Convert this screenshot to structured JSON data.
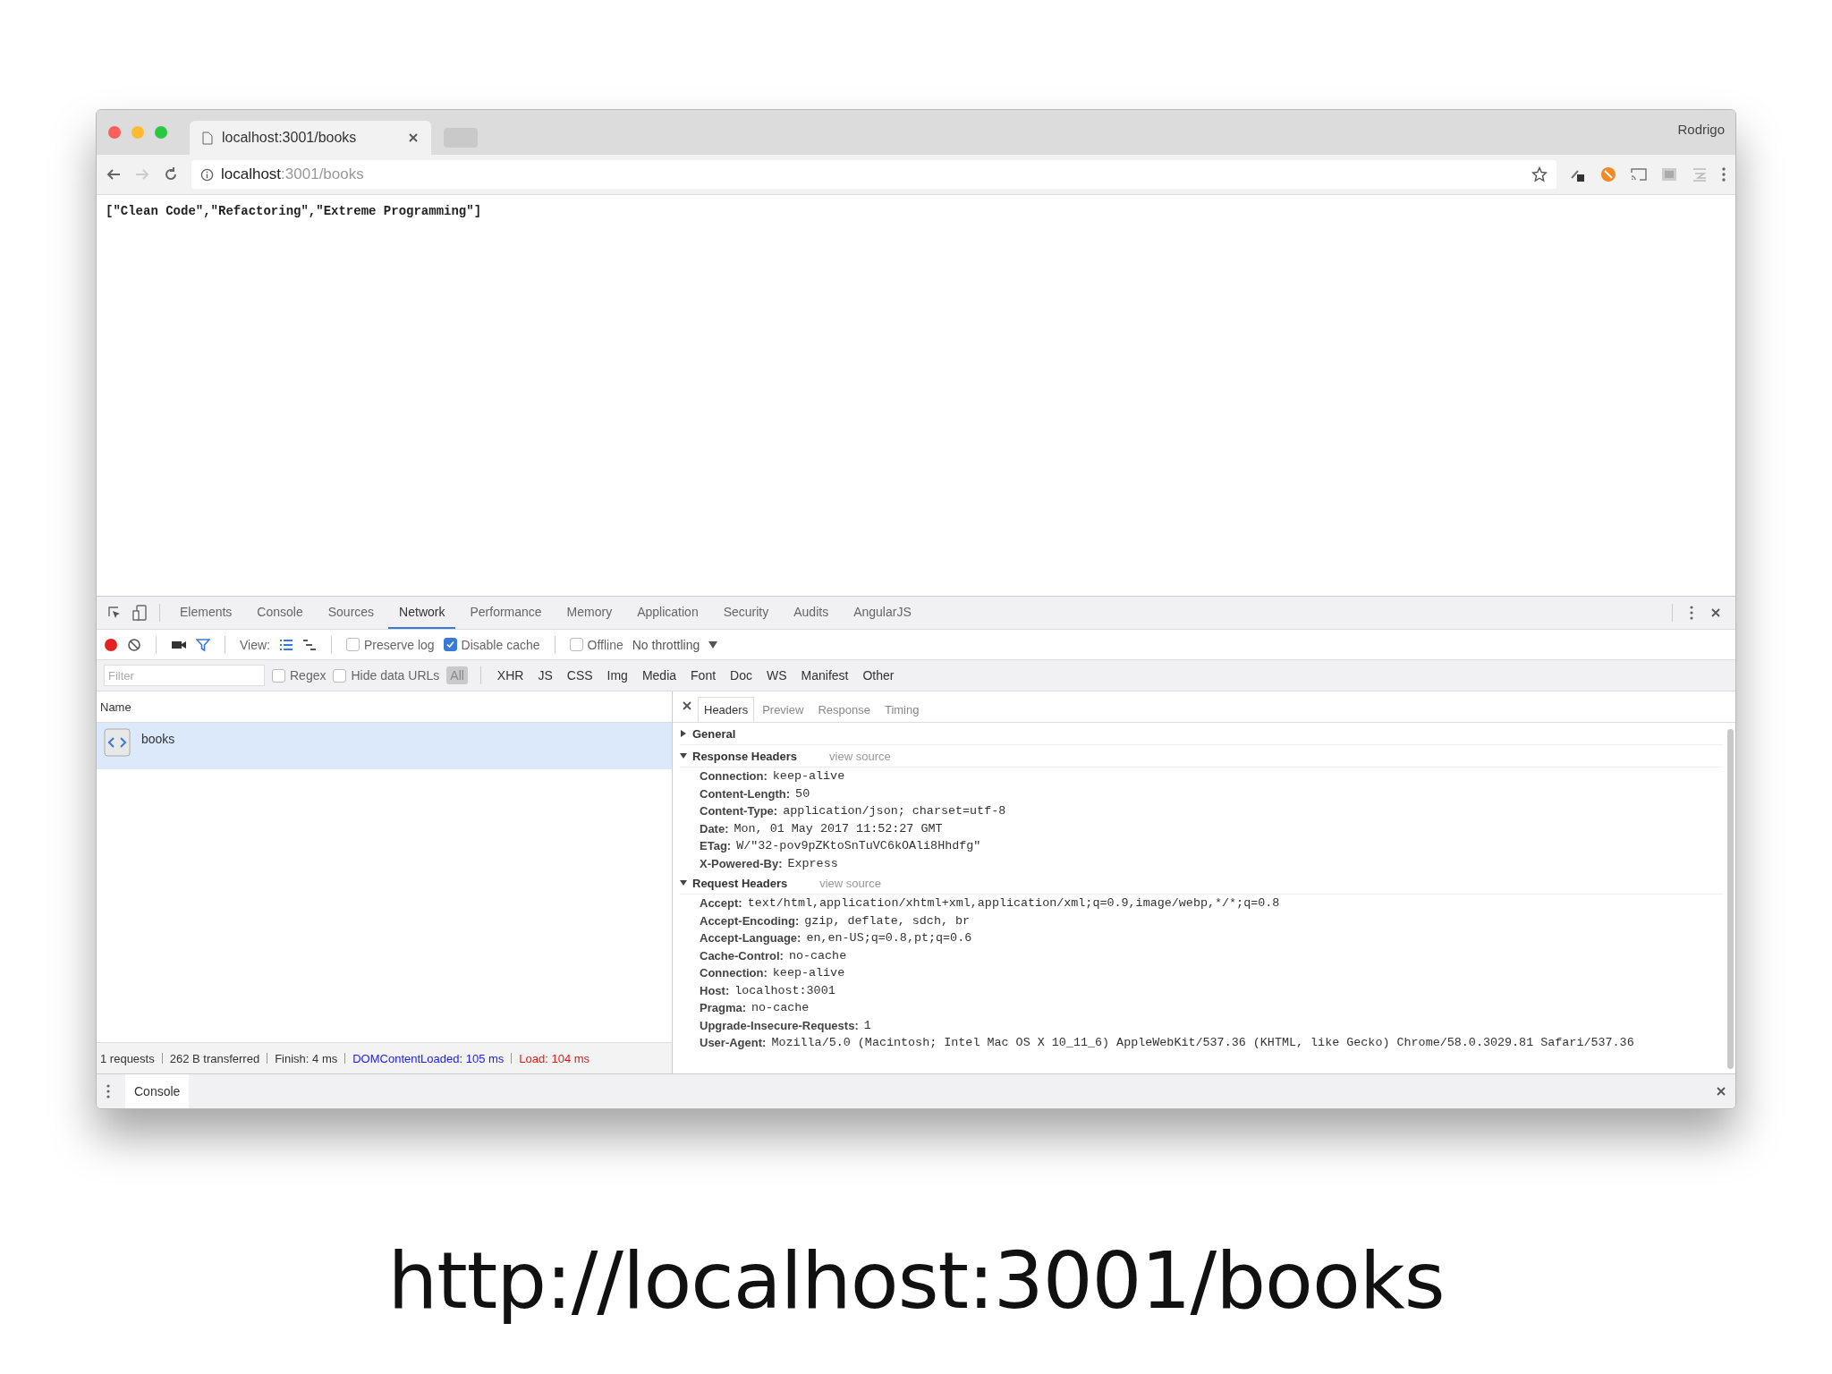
{
  "browser": {
    "tab_title": "localhost:3001/books",
    "profile": "Rodrigo",
    "url_host": "localhost",
    "url_path": ":3001/books"
  },
  "page_text": "[\"Clean Code\",\"Refactoring\",\"Extreme Programming\"]",
  "devtools": {
    "tabs": [
      {
        "label": "Elements",
        "selected": false
      },
      {
        "label": "Console",
        "selected": false
      },
      {
        "label": "Sources",
        "selected": false
      },
      {
        "label": "Network",
        "selected": true
      },
      {
        "label": "Performance",
        "selected": false
      },
      {
        "label": "Memory",
        "selected": false
      },
      {
        "label": "Application",
        "selected": false
      },
      {
        "label": "Security",
        "selected": false
      },
      {
        "label": "Audits",
        "selected": false
      },
      {
        "label": "AngularJS",
        "selected": false
      }
    ],
    "toolbar": {
      "view_label": "View:",
      "options": [
        {
          "label": "Preserve log",
          "checked": false
        },
        {
          "label": "Disable cache",
          "checked": true
        },
        {
          "label": "Offline",
          "checked": false
        }
      ],
      "throttling": "No throttling"
    },
    "filter": {
      "placeholder": "Filter",
      "options": [
        {
          "label": "Regex",
          "checked": false
        },
        {
          "label": "Hide data URLs",
          "checked": false
        }
      ],
      "types": [
        {
          "label": "All",
          "selected": true
        },
        {
          "label": "XHR",
          "selected": false
        },
        {
          "label": "JS",
          "selected": false
        },
        {
          "label": "CSS",
          "selected": false
        },
        {
          "label": "Img",
          "selected": false
        },
        {
          "label": "Media",
          "selected": false
        },
        {
          "label": "Font",
          "selected": false
        },
        {
          "label": "Doc",
          "selected": false
        },
        {
          "label": "WS",
          "selected": false
        },
        {
          "label": "Manifest",
          "selected": false
        },
        {
          "label": "Other",
          "selected": false
        }
      ]
    },
    "requests": {
      "column": "Name",
      "rows": [
        {
          "name": "books",
          "selected": true
        }
      ]
    },
    "summary": [
      {
        "text": "1 requests",
        "kind": "plain"
      },
      {
        "text": "262 B transferred",
        "kind": "plain"
      },
      {
        "text": "Finish: 4 ms",
        "kind": "plain"
      },
      {
        "text": "DOMContentLoaded: 105 ms",
        "kind": "dom"
      },
      {
        "text": "Load: 104 ms",
        "kind": "load"
      }
    ],
    "details": {
      "tabs": [
        {
          "label": "Headers",
          "selected": true
        },
        {
          "label": "Preview",
          "selected": false
        },
        {
          "label": "Response",
          "selected": false
        },
        {
          "label": "Timing",
          "selected": false
        }
      ],
      "sections": [
        {
          "title": "General",
          "expanded": false
        },
        {
          "title": "Response Headers",
          "expanded": true,
          "link": "view source",
          "headers": [
            {
              "name": "Connection:",
              "value": "keep-alive"
            },
            {
              "name": "Content-Length:",
              "value": "50"
            },
            {
              "name": "Content-Type:",
              "value": "application/json; charset=utf-8"
            },
            {
              "name": "Date:",
              "value": "Mon, 01 May 2017 11:52:27 GMT"
            },
            {
              "name": "ETag:",
              "value": "W/\"32-pov9pZKtoSnTuVC6kOAli8Hhdfg\""
            },
            {
              "name": "X-Powered-By:",
              "value": "Express"
            }
          ]
        },
        {
          "title": "Request Headers",
          "expanded": true,
          "link": "view source",
          "headers": [
            {
              "name": "Accept:",
              "value": "text/html,application/xhtml+xml,application/xml;q=0.9,image/webp,*/*;q=0.8"
            },
            {
              "name": "Accept-Encoding:",
              "value": "gzip, deflate, sdch, br"
            },
            {
              "name": "Accept-Language:",
              "value": "en,en-US;q=0.8,pt;q=0.6"
            },
            {
              "name": "Cache-Control:",
              "value": "no-cache"
            },
            {
              "name": "Connection:",
              "value": "keep-alive"
            },
            {
              "name": "Host:",
              "value": "localhost:3001"
            },
            {
              "name": "Pragma:",
              "value": "no-cache"
            },
            {
              "name": "Upgrade-Insecure-Requests:",
              "value": "1"
            },
            {
              "name": "User-Agent:",
              "value": "Mozilla/5.0 (Macintosh; Intel Mac OS X 10_11_6) AppleWebKit/537.36 (KHTML, like Gecko) Chrome/58.0.3029.81 Safari/537.36"
            }
          ]
        }
      ]
    },
    "drawer": {
      "tab": "Console"
    }
  },
  "caption": "http://localhost:3001/books"
}
